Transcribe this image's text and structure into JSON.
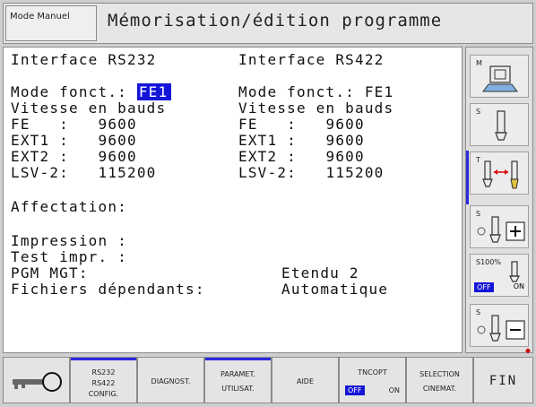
{
  "header": {
    "mode": "Mode Manuel",
    "title": "Mémorisation/édition programme"
  },
  "rs232": {
    "title": "Interface RS232",
    "mode_label": "Mode fonct.:",
    "mode_value": "FE1",
    "baud_label": "Vitesse en bauds",
    "fe": "FE   :   9600",
    "ext1": "EXT1 :   9600",
    "ext2": "EXT2 :   9600",
    "lsv2": "LSV-2:   115200"
  },
  "rs422": {
    "title": "Interface RS422",
    "mode_line": "Mode fonct.: FE1",
    "baud_label": "Vitesse en bauds",
    "fe": "FE   :   9600",
    "ext1": "EXT1 :   9600",
    "ext2": "EXT2 :   9600",
    "lsv2": "LSV-2:   115200"
  },
  "affectation": {
    "title": "Affectation:",
    "impression": "Impression :",
    "test_impr": "Test impr. :",
    "pgm_mgt_label": "PGM MGT:",
    "pgm_mgt_value": "Etendu 2",
    "fichiers_label": "Fichiers dépendants:",
    "fichiers_value": "Automatique"
  },
  "side": {
    "m": "M",
    "s": "S",
    "t": "T",
    "s2": "S",
    "s100": "S100%",
    "off": "OFF",
    "on": "ON",
    "s3": "S"
  },
  "softkeys": {
    "rs_l1": "RS232",
    "rs_l2": "RS422",
    "rs_l3": "CONFIG.",
    "diagnost": "DIAGNOST.",
    "param_l1": "PARAMET.",
    "param_l2": "UTILISAT.",
    "aide": "AIDE",
    "tncopt": "TNCOPT",
    "tncopt_off": "OFF",
    "tncopt_on": "ON",
    "sel_l1": "SELECTION",
    "sel_l2": "CINEMAT.",
    "fin": "FIN"
  },
  "colors": {
    "accent": "#1515d8"
  }
}
